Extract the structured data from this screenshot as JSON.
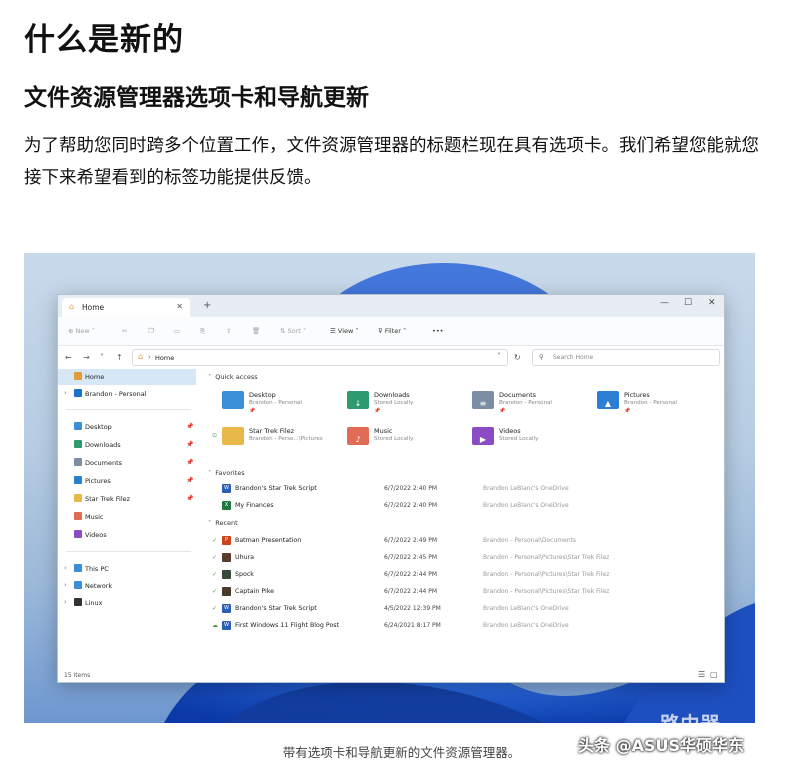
{
  "article": {
    "title": "什么是新的",
    "subtitle": "文件资源管理器选项卡和导航更新",
    "paragraph": "为了帮助您同时跨多个位置工作，文件资源管理器的标题栏现在具有选项卡。我们希望您能就您接下来希望看到的标签功能提供反馈。",
    "caption": "带有选项卡和导航更新的文件资源管理器。",
    "watermark": "头条 @ASUS华硕华东",
    "watermark_logo": "路由器"
  },
  "explorer": {
    "tab_label": "Home",
    "tab_icon": "home-icon",
    "new_tab_symbol": "+",
    "window_controls": [
      "—",
      "☐",
      "✕"
    ],
    "commands": {
      "new": "New",
      "sort": "Sort",
      "view": "View",
      "filter": "Filter",
      "more": "•••"
    },
    "address": "Home",
    "search_placeholder": "Search Home",
    "sidebar": [
      {
        "label": "Home",
        "selected": true,
        "color": "#e39b38",
        "chevron": ""
      },
      {
        "label": "Brandon - Personal",
        "color": "#1a73c7",
        "chevron": "›"
      },
      {
        "label": "Desktop",
        "color": "#3b8fd8",
        "pin": true
      },
      {
        "label": "Downloads",
        "color": "#2d9b6f",
        "pin": true
      },
      {
        "label": "Documents",
        "color": "#7b8ea3",
        "pin": true
      },
      {
        "label": "Pictures",
        "color": "#2a7fd4",
        "pin": true
      },
      {
        "label": "Star Trek Filez",
        "color": "#e8b84a",
        "pin": true
      },
      {
        "label": "Music",
        "color": "#e06c55",
        "pin": false
      },
      {
        "label": "Videos",
        "color": "#8a4bc4",
        "pin": false
      },
      {
        "label": "This PC",
        "color": "#3b8fd8",
        "chevron": "›"
      },
      {
        "label": "Network",
        "color": "#3b8fd8",
        "chevron": "›"
      },
      {
        "label": "Linux",
        "color": "#333333",
        "chevron": "›"
      }
    ],
    "sections": {
      "quick_access": "Quick access",
      "favorites": "Favorites",
      "recent": "Recent"
    },
    "quick_access": [
      {
        "name": "Desktop",
        "sub": "Brandon - Personal",
        "color": "#3b8fd8",
        "glyph": "",
        "pinned": true
      },
      {
        "name": "Downloads",
        "sub": "Stored Locally",
        "color": "#2d9b6f",
        "glyph": "↓",
        "pinned": true
      },
      {
        "name": "Documents",
        "sub": "Brandon - Personal",
        "color": "#7b8ea3",
        "glyph": "≡",
        "pinned": true
      },
      {
        "name": "Pictures",
        "sub": "Brandon - Personal",
        "color": "#2a7fd4",
        "glyph": "▲",
        "pinned": true
      },
      {
        "name": "Star Trek Filez",
        "sub": "Brandon - Perso...\\Pictures",
        "color": "#e8b84a",
        "glyph": "",
        "pinned": false,
        "synced": true
      },
      {
        "name": "Music",
        "sub": "Stored Locally",
        "color": "#e06c55",
        "glyph": "♪",
        "pinned": false
      },
      {
        "name": "Videos",
        "sub": "Stored Locally",
        "color": "#8a4bc4",
        "glyph": "▶",
        "pinned": false
      }
    ],
    "favorites": [
      {
        "name": "Brandon's Star Trek Script",
        "date": "6/7/2022 2:40 PM",
        "location": "Brandon LeBlanc's OneDrive",
        "color": "#2b5fb8",
        "glyph": "W",
        "status": ""
      },
      {
        "name": "My Finances",
        "date": "6/7/2022 2:40 PM",
        "location": "Brandon LeBlanc's OneDrive",
        "color": "#1f7a3f",
        "glyph": "X",
        "status": ""
      }
    ],
    "recent": [
      {
        "name": "Batman Presentation",
        "date": "6/7/2022 2:49 PM",
        "location": "Brandon - Personal\\Documents",
        "color": "#c8461f",
        "glyph": "P",
        "status": "✓"
      },
      {
        "name": "Uhura",
        "date": "6/7/2022 2:45 PM",
        "location": "Brandon - Personal\\Pictures\\Star Trek Filez",
        "color": "#5a3a2a",
        "glyph": "",
        "status": "✓"
      },
      {
        "name": "Spock",
        "date": "6/7/2022 2:44 PM",
        "location": "Brandon - Personal\\Pictures\\Star Trek Filez",
        "color": "#3a4a3a",
        "glyph": "",
        "status": "✓"
      },
      {
        "name": "Captain Pike",
        "date": "6/7/2022 2:44 PM",
        "location": "Brandon - Personal\\Pictures\\Star Trek Filez",
        "color": "#4a3a2a",
        "glyph": "",
        "status": "✓"
      },
      {
        "name": "Brandon's Star Trek Script",
        "date": "4/5/2022 12:39 PM",
        "location": "Brandon LeBlanc's OneDrive",
        "color": "#2b5fb8",
        "glyph": "W",
        "status": "✓"
      },
      {
        "name": "First Windows 11 Flight Blog Post",
        "date": "6/24/2021 8:17 PM",
        "location": "Brandon LeBlanc's OneDrive",
        "color": "#2b5fb8",
        "glyph": "W",
        "status": "☁"
      }
    ],
    "status_text": "15 items"
  }
}
